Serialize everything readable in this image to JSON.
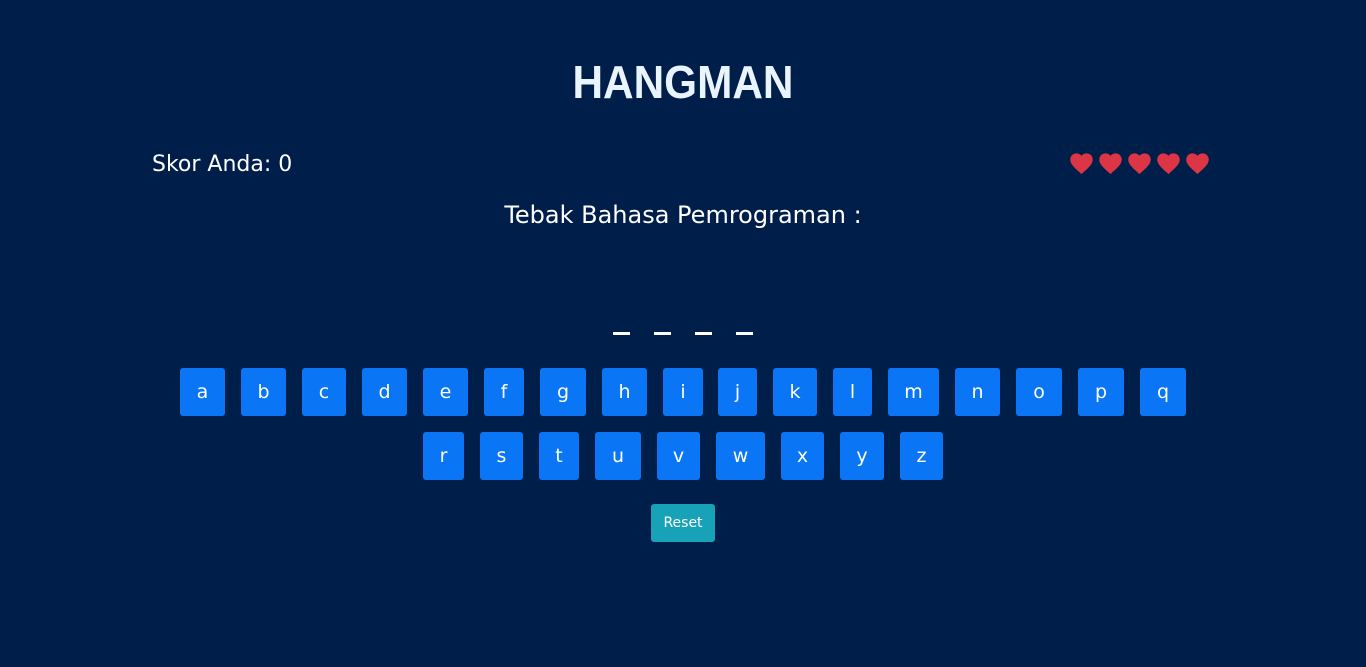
{
  "game": {
    "title": "HANGMAN",
    "score_text": "Skor Anda: 0",
    "prompt": "Tebak Bahasa Pemrograman :",
    "lives": 5,
    "heart_color": "#dc3545",
    "word_blanks": [
      "_",
      "_",
      "_",
      "_"
    ]
  },
  "keyboard": {
    "row1": [
      "a",
      "b",
      "c",
      "d",
      "e",
      "f",
      "g",
      "h",
      "i",
      "j",
      "k",
      "l",
      "m",
      "n",
      "o",
      "p",
      "q"
    ],
    "row2": [
      "r",
      "s",
      "t",
      "u",
      "v",
      "w",
      "x",
      "y",
      "z"
    ],
    "key_color": "#0a76f6"
  },
  "controls": {
    "reset_label": "Reset",
    "reset_color": "#17a2b8"
  },
  "colors": {
    "background": "#001e4a",
    "text": "#ffffff"
  }
}
